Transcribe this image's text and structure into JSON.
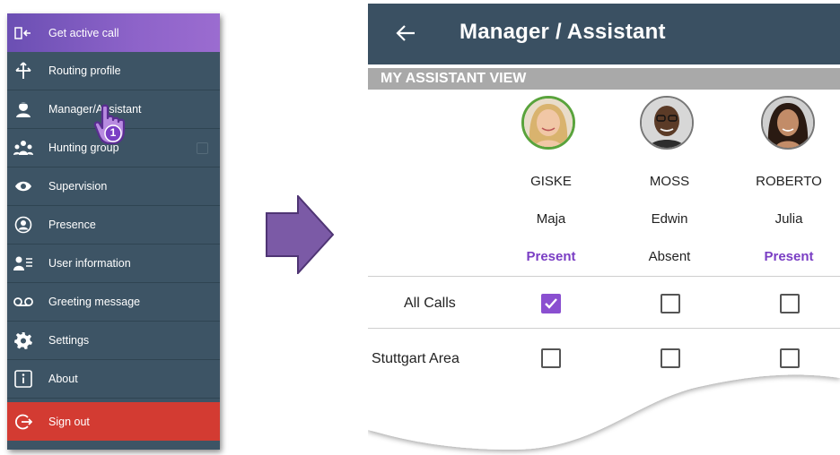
{
  "menu": {
    "items": [
      {
        "label": "Get active call",
        "icon": "active-call-icon"
      },
      {
        "label": "Routing profile",
        "icon": "routing-icon"
      },
      {
        "label": "Manager/Assistant",
        "icon": "manager-icon"
      },
      {
        "label": "Hunting group",
        "icon": "hunting-group-icon"
      },
      {
        "label": "Supervision",
        "icon": "eye-icon"
      },
      {
        "label": "Presence",
        "icon": "presence-icon"
      },
      {
        "label": "User information",
        "icon": "user-info-icon"
      },
      {
        "label": "Greeting message",
        "icon": "voicemail-icon"
      },
      {
        "label": "Settings",
        "icon": "gear-icon"
      },
      {
        "label": "About",
        "icon": "info-icon"
      },
      {
        "label": "Sign out",
        "icon": "sign-out-icon"
      }
    ],
    "tap_badge": "1",
    "colors": {
      "menu_bg": "#3d5465",
      "top_bg": "#7d59c0",
      "signout_bg": "#d33b32"
    }
  },
  "screen": {
    "title": "Manager / Assistant",
    "section": "MY ASSISTANT VIEW",
    "managers": [
      {
        "last": "GISKE",
        "first": "Maja",
        "status": "Present"
      },
      {
        "last": "MOSS",
        "first": "Edwin",
        "status": "Absent"
      },
      {
        "last": "ROBERTO",
        "first": "Julia",
        "status": "Present"
      }
    ],
    "rows": [
      {
        "label": "All Calls",
        "checks": [
          true,
          false,
          false
        ]
      },
      {
        "label": "Stuttgart Area",
        "checks": [
          false,
          false,
          false
        ]
      }
    ],
    "colors": {
      "appbar": "#3a5062",
      "accent": "#8a4fd0",
      "band": "#a9a9a9"
    }
  }
}
